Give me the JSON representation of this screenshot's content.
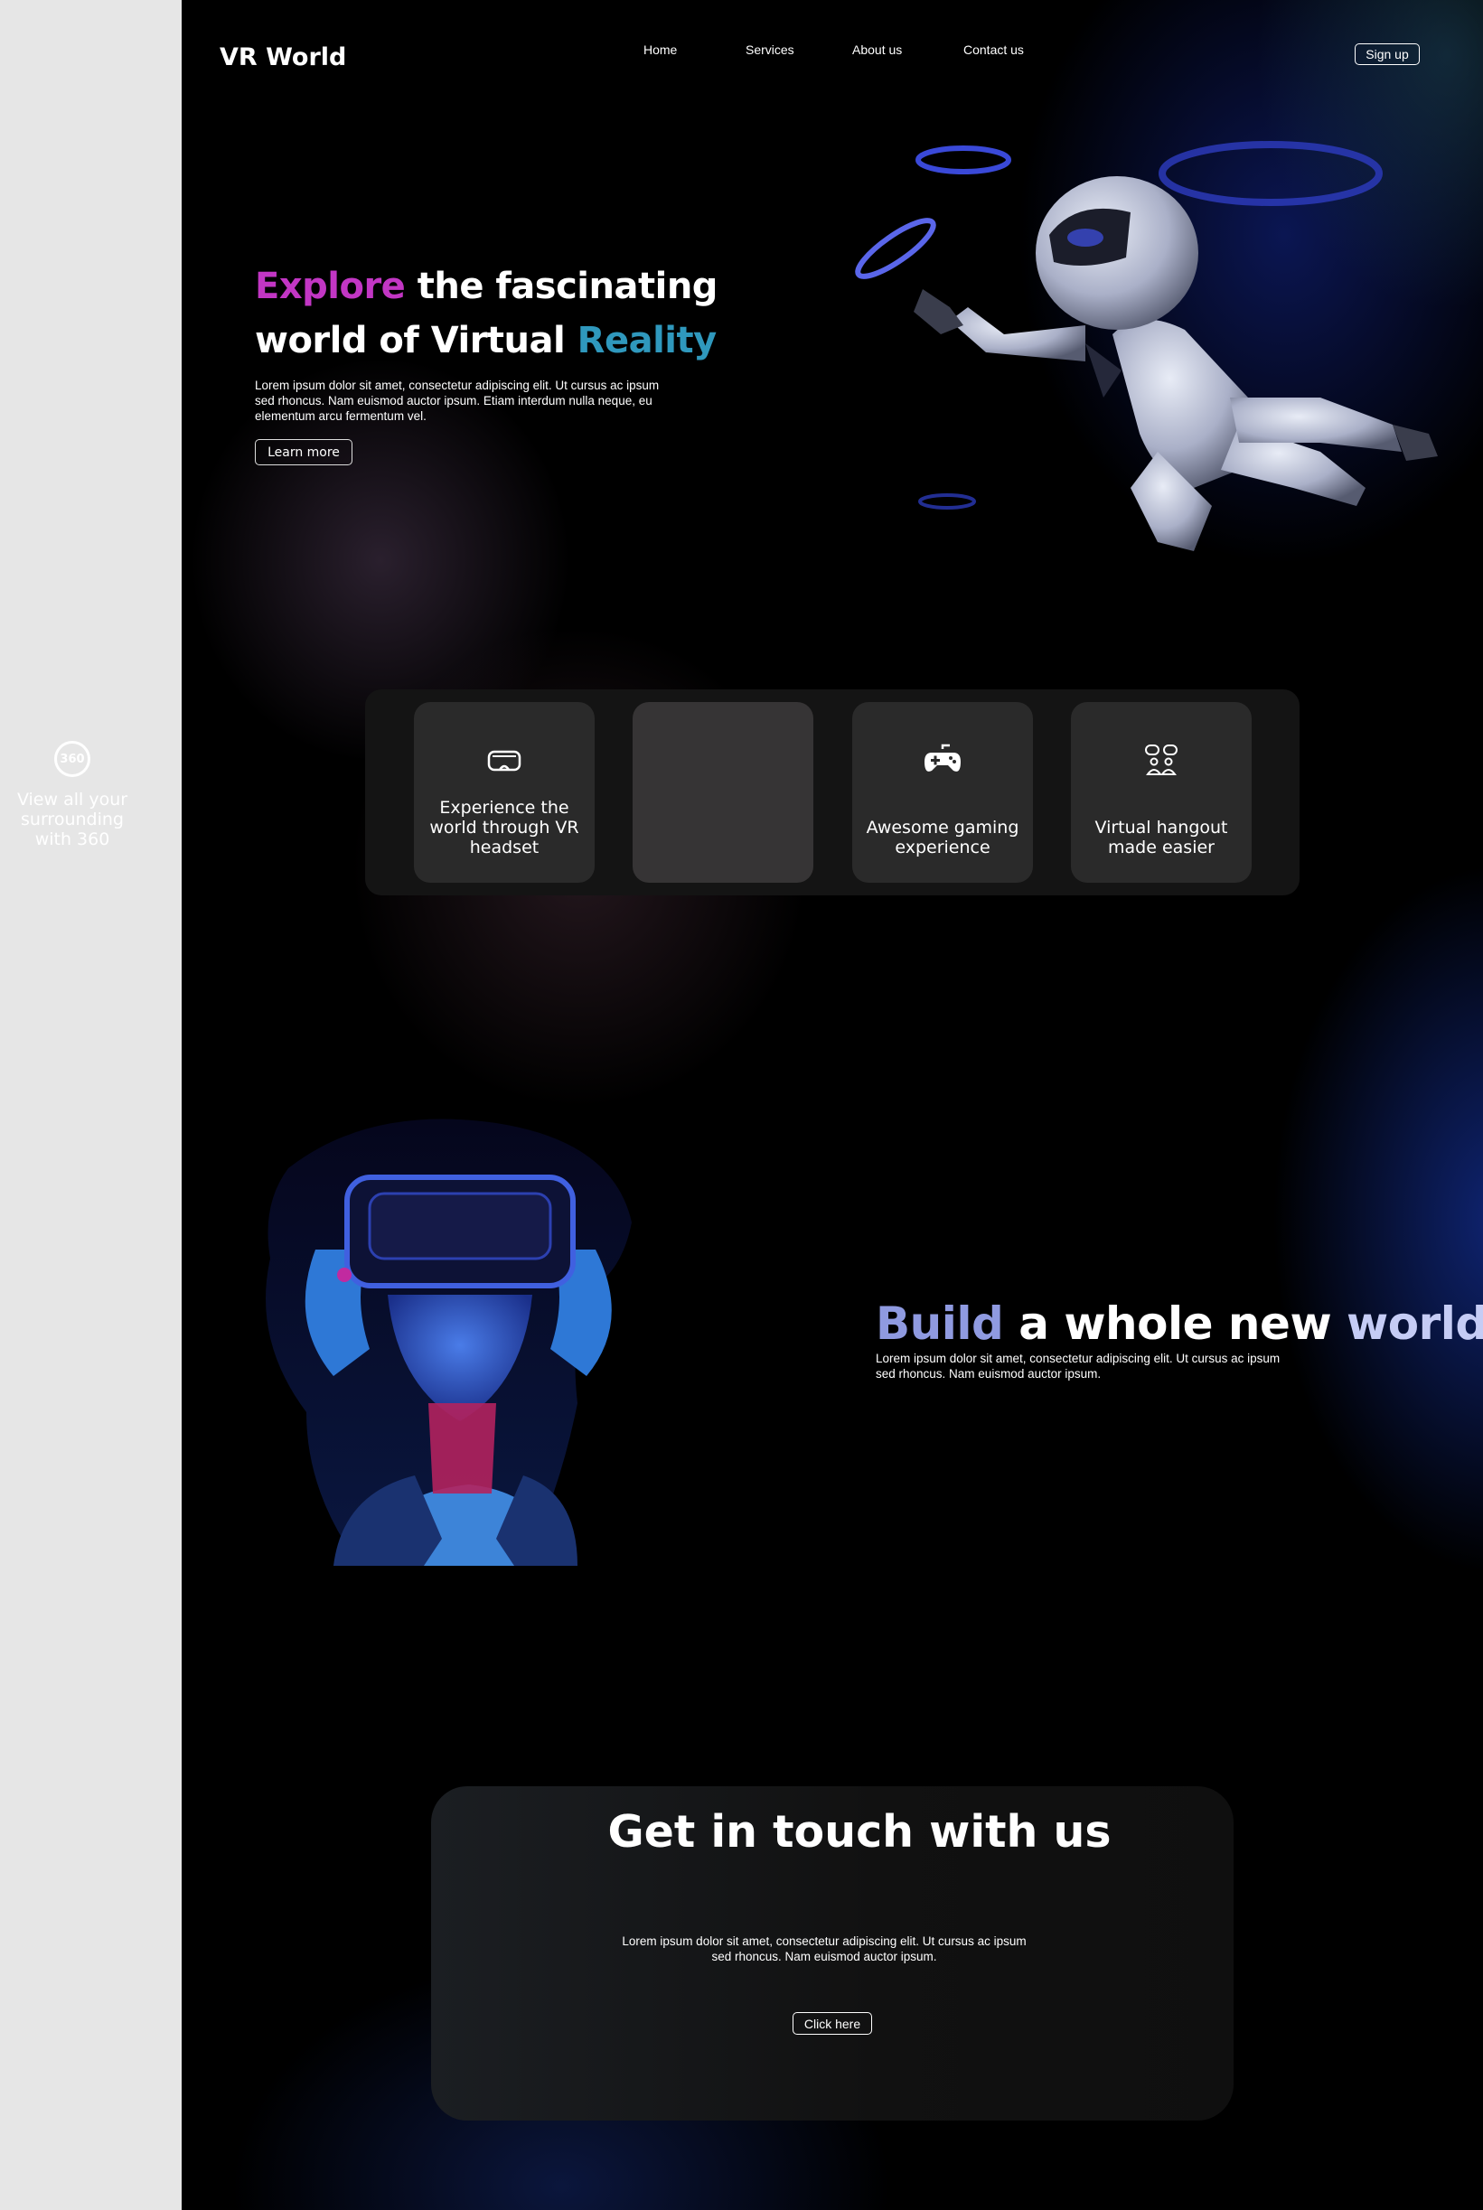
{
  "sidebar": {
    "icon_text": "360",
    "feature_text": "View all your surrounding with 360"
  },
  "header": {
    "logo": "VR World",
    "nav": [
      "Home",
      "Services",
      "About us",
      "Contact us"
    ],
    "signup_label": "Sign up"
  },
  "hero": {
    "title_accent": "Explore",
    "title_middle": " the fascinating world of Virtual ",
    "title_end": "Reality",
    "description": "Lorem ipsum dolor sit amet, consectetur adipiscing elit. Ut cursus ac ipsum sed rhoncus. Nam euismod auctor ipsum. Etiam interdum nulla neque, eu elementum arcu fermentum vel.",
    "cta_label": "Learn more"
  },
  "features": [
    {
      "icon": "vr-headset-icon",
      "label": "Experience the world through VR headset"
    },
    {
      "icon": "",
      "label": ""
    },
    {
      "icon": "gamepad-icon",
      "label": "Awesome gaming experience"
    },
    {
      "icon": "people-hangout-icon",
      "label": "Virtual hangout made easier"
    }
  ],
  "build": {
    "title_accent": "Build",
    "title_middle": " a whole new ",
    "title_end": "world",
    "description": "Lorem ipsum dolor sit amet, consectetur adipiscing elit. Ut cursus ac ipsum sed rhoncus. Nam euismod auctor ipsum."
  },
  "contact": {
    "title": "Get in touch with us",
    "description": "Lorem ipsum dolor sit amet, consectetur adipiscing elit. Ut cursus ac ipsum sed rhoncus. Nam euismod auctor ipsum.",
    "cta_label": "Click here"
  },
  "colors": {
    "accent_magenta": "#c236c4",
    "accent_teal": "#2f98bd",
    "accent_lavender": "#8f9ae0",
    "ring_blue": "#3a49d8"
  }
}
